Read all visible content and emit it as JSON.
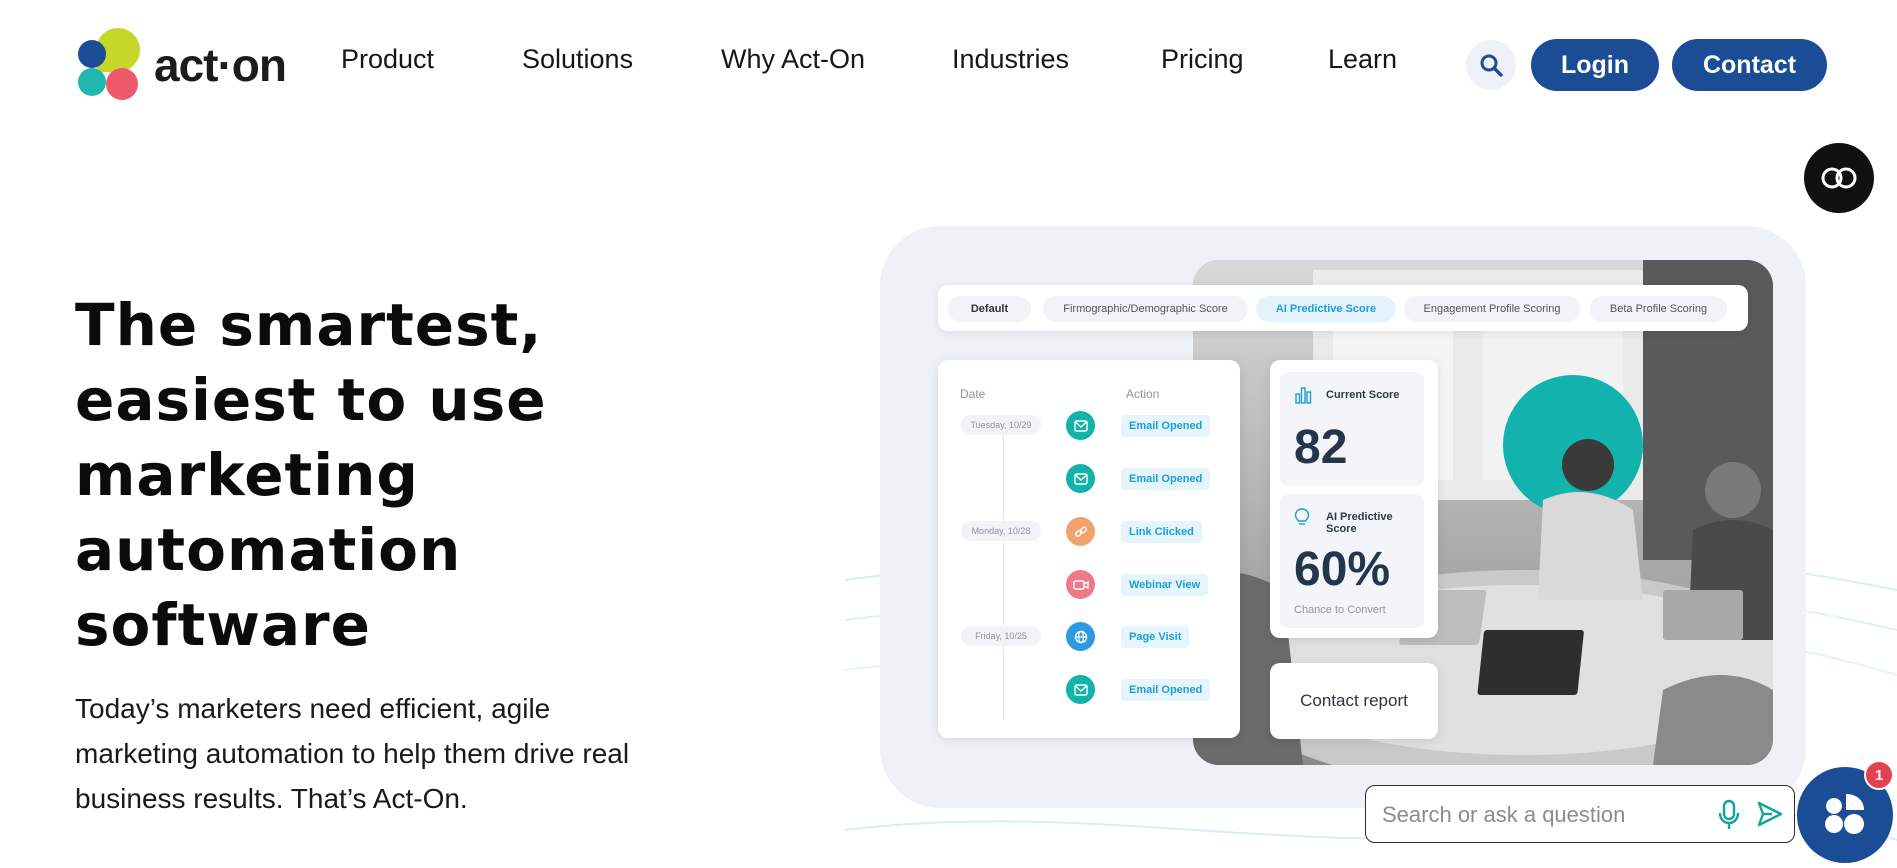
{
  "brand": {
    "logo_text": "act·on",
    "colors": {
      "lime": "#c6d72a",
      "teal": "#1fb7b0",
      "blue": "#1b4d96",
      "coral": "#ef5a6b"
    }
  },
  "nav": {
    "items": [
      {
        "label": "Product"
      },
      {
        "label": "Solutions"
      },
      {
        "label": "Why Act-On"
      },
      {
        "label": "Industries"
      },
      {
        "label": "Pricing"
      },
      {
        "label": "Learn"
      }
    ],
    "search_icon": "search-icon",
    "login_label": "Login",
    "contact_label": "Contact",
    "accent_color": "#1b4d96"
  },
  "accessibility": {
    "captions_icon": "closed-captions-icon"
  },
  "hero": {
    "title": "The smartest, easiest to use marketing automation software",
    "subtitle": "Today’s marketers need efficient, agile marketing automation to help them drive real business results. That’s Act-On."
  },
  "dashboard": {
    "tabs": [
      {
        "label": "Default"
      },
      {
        "label": "Firmographic/Demographic Score"
      },
      {
        "label": "AI Predictive Score"
      },
      {
        "label": "Engagement Profile Scoring"
      },
      {
        "label": "Beta Profile Scoring"
      }
    ],
    "activity": {
      "date_header": "Date",
      "action_header": "Action",
      "dates": [
        "Tuesday, 10/29",
        "Monday, 10/28",
        "Friday, 10/25"
      ],
      "actions": [
        {
          "label": "Email Opened",
          "icon": "mail-icon"
        },
        {
          "label": "Email Opened",
          "icon": "mail-icon"
        },
        {
          "label": "Link Clicked",
          "icon": "link-icon"
        },
        {
          "label": "Webinar View",
          "icon": "video-icon"
        },
        {
          "label": "Page Visit",
          "icon": "globe-icon"
        },
        {
          "label": "Email Opened",
          "icon": "mail-icon"
        }
      ]
    },
    "score": {
      "current_label": "Current Score",
      "current_value": "82",
      "ai_label": "AI Predictive Score",
      "ai_value": "60%",
      "ai_caption": "Chance to Convert"
    },
    "contact_report_label": "Contact report"
  },
  "chat": {
    "placeholder": "Search or ask a question",
    "badge_count": "1"
  }
}
